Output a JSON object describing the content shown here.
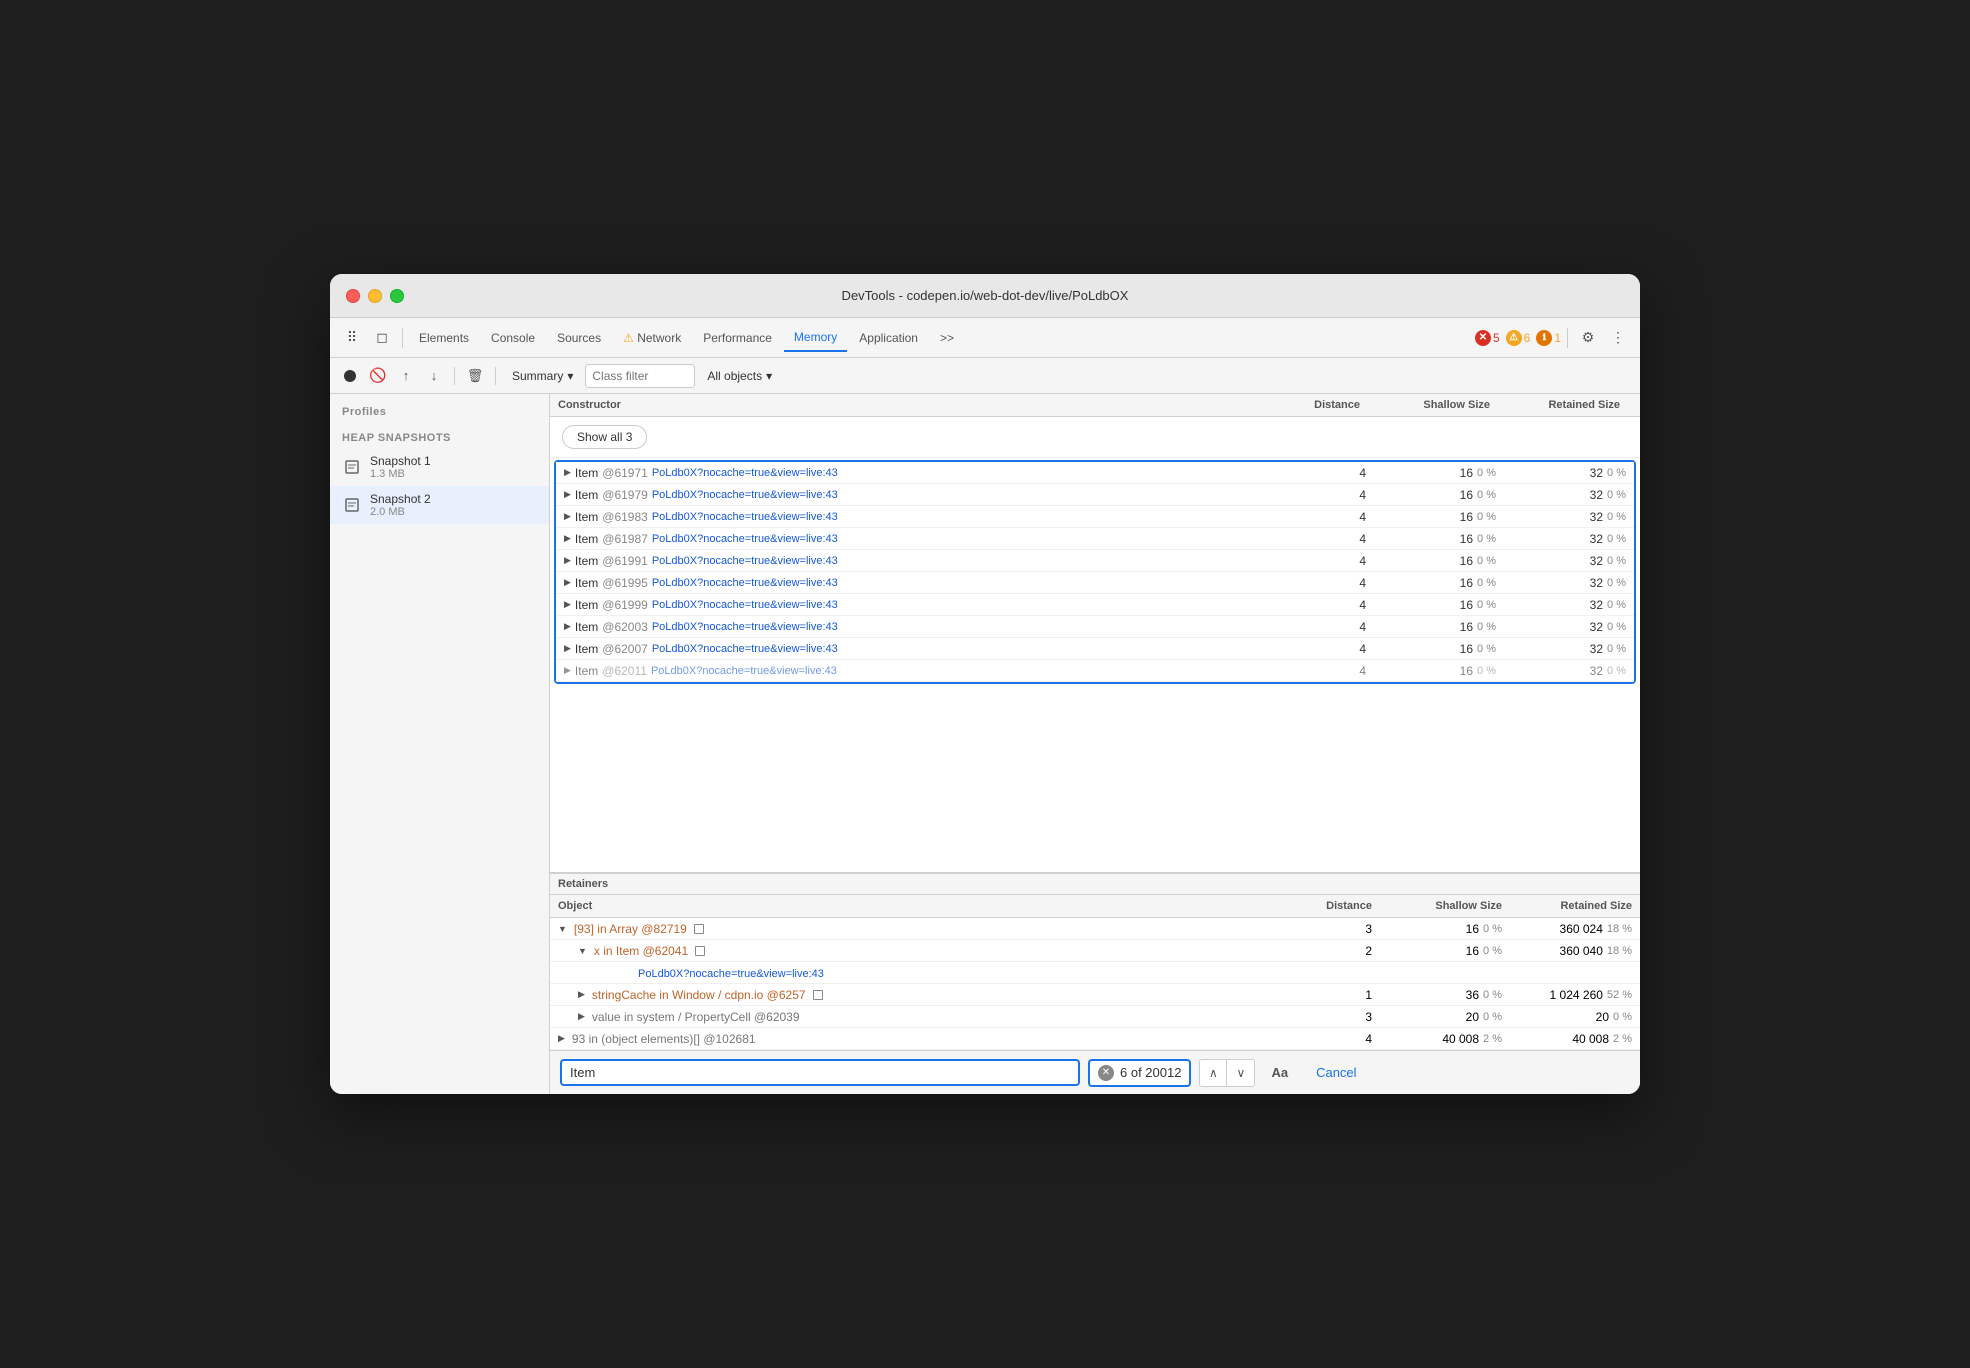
{
  "titlebar": {
    "title": "DevTools - codepen.io/web-dot-dev/live/PoLdbOX"
  },
  "tabs": {
    "items": [
      {
        "id": "elements",
        "label": "Elements",
        "active": false,
        "warning": false
      },
      {
        "id": "console",
        "label": "Console",
        "active": false,
        "warning": false
      },
      {
        "id": "sources",
        "label": "Sources",
        "active": false,
        "warning": false
      },
      {
        "id": "network",
        "label": "Network",
        "active": false,
        "warning": true,
        "warn_icon": "⚠"
      },
      {
        "id": "performance",
        "label": "Performance",
        "active": false,
        "warning": false
      },
      {
        "id": "memory",
        "label": "Memory",
        "active": true,
        "warning": false
      },
      {
        "id": "application",
        "label": "Application",
        "active": false,
        "warning": false
      }
    ],
    "overflow": ">>",
    "error_count": "5",
    "warn_count": "6",
    "info_count": "1"
  },
  "toolbar2": {
    "summary_label": "Summary",
    "class_filter_placeholder": "Class filter",
    "all_objects_label": "All objects"
  },
  "sidebar": {
    "profiles_title": "Profiles",
    "heap_snapshots_label": "HEAP SNAPSHOTS",
    "snapshots": [
      {
        "name": "Snapshot 1",
        "size": "1.3 MB"
      },
      {
        "name": "Snapshot 2",
        "size": "2.0 MB"
      }
    ]
  },
  "constructor_table": {
    "headers": {
      "constructor": "Constructor",
      "distance": "Distance",
      "shallow_size": "Shallow Size",
      "retained_size": "Retained Size"
    },
    "show_all_label": "Show all 3",
    "rows": [
      {
        "name": "Item",
        "id": "@61971",
        "link": "PoLdb0X?nocache=true&view=live:43",
        "dist": "4",
        "shallow": "16",
        "shallow_pct": "0 %",
        "retained": "32",
        "retained_pct": "0 %",
        "selected": true
      },
      {
        "name": "Item",
        "id": "@61979",
        "link": "PoLdb0X?nocache=true&view=live:43",
        "dist": "4",
        "shallow": "16",
        "shallow_pct": "0 %",
        "retained": "32",
        "retained_pct": "0 %",
        "selected": false
      },
      {
        "name": "Item",
        "id": "@61983",
        "link": "PoLdb0X?nocache=true&view=live:43",
        "dist": "4",
        "shallow": "16",
        "shallow_pct": "0 %",
        "retained": "32",
        "retained_pct": "0 %",
        "selected": false
      },
      {
        "name": "Item",
        "id": "@61987",
        "link": "PoLdb0X?nocache=true&view=live:43",
        "dist": "4",
        "shallow": "16",
        "shallow_pct": "0 %",
        "retained": "32",
        "retained_pct": "0 %",
        "selected": false
      },
      {
        "name": "Item",
        "id": "@61991",
        "link": "PoLdb0X?nocache=true&view=live:43",
        "dist": "4",
        "shallow": "16",
        "shallow_pct": "0 %",
        "retained": "32",
        "retained_pct": "0 %",
        "selected": false
      },
      {
        "name": "Item",
        "id": "@61995",
        "link": "PoLdb0X?nocache=true&view=live:43",
        "dist": "4",
        "shallow": "16",
        "shallow_pct": "0 %",
        "retained": "32",
        "retained_pct": "0 %",
        "selected": false
      },
      {
        "name": "Item",
        "id": "@61999",
        "link": "PoLdb0X?nocache=true&view=live:43",
        "dist": "4",
        "shallow": "16",
        "shallow_pct": "0 %",
        "retained": "32",
        "retained_pct": "0 %",
        "selected": false
      },
      {
        "name": "Item",
        "id": "@62003",
        "link": "PoLdb0X?nocache=true&view=live:43",
        "dist": "4",
        "shallow": "16",
        "shallow_pct": "0 %",
        "retained": "32",
        "retained_pct": "0 %",
        "selected": false
      },
      {
        "name": "Item",
        "id": "@62007",
        "link": "PoLdb0X?nocache=true&view=live:43",
        "dist": "4",
        "shallow": "16",
        "shallow_pct": "0 %",
        "retained": "32",
        "retained_pct": "0 %",
        "selected": false
      },
      {
        "name": "Item",
        "id": "@62011",
        "link": "PoLdb0X?nocache=true&view=live:43",
        "dist": "4",
        "shallow": "16",
        "shallow_pct": "0 %",
        "retained": "32",
        "retained_pct": "0 %",
        "selected": false
      }
    ]
  },
  "retainers": {
    "header": "Retainers",
    "table_headers": {
      "object": "Object",
      "distance": "Distance",
      "shallow_size": "Shallow Size",
      "retained_size": "Retained Size"
    },
    "rows": [
      {
        "type": "row1",
        "label": "[93] in Array @82719",
        "box": true,
        "dist": "3",
        "shallow": "16",
        "shallow_pct": "0 %",
        "retained": "360 024",
        "retained_pct": "18 %",
        "indent": 0,
        "arrow": "▼",
        "orange": true
      },
      {
        "type": "row2",
        "label": "x in Item @62041",
        "box": true,
        "dist": "2",
        "shallow": "16",
        "shallow_pct": "0 %",
        "retained": "360 040",
        "retained_pct": "18 %",
        "indent": 1,
        "arrow": "▼",
        "orange": true
      },
      {
        "type": "row3",
        "link": "PoLdb0X?nocache=true&view=live:43",
        "dist": "",
        "shallow": "",
        "shallow_pct": "",
        "retained": "",
        "retained_pct": "",
        "indent": 2,
        "arrow": "",
        "orange": false,
        "is_link": true
      },
      {
        "type": "row4",
        "label": "stringCache in Window / cdpn.io @6257",
        "box": true,
        "dist": "1",
        "shallow": "36",
        "shallow_pct": "0 %",
        "retained": "1 024 260",
        "retained_pct": "52 %",
        "indent": 1,
        "arrow": "▶",
        "orange": true
      },
      {
        "type": "row5",
        "label": "value in system / PropertyCell @62039",
        "box": false,
        "dist": "3",
        "shallow": "20",
        "shallow_pct": "0 %",
        "retained": "20",
        "retained_pct": "0 %",
        "indent": 1,
        "arrow": "▶",
        "orange": false,
        "gray": true
      },
      {
        "type": "row6",
        "label": "93 in (object elements)[] @102681",
        "box": false,
        "dist": "4",
        "shallow": "40 008",
        "shallow_pct": "2 %",
        "retained": "40 008",
        "retained_pct": "2 %",
        "indent": 0,
        "arrow": "▶",
        "orange": false,
        "gray": true
      }
    ]
  },
  "search_bar": {
    "input_value": "Item",
    "count_text": "6 of 20012",
    "aa_label": "Aa",
    "cancel_label": "Cancel"
  }
}
